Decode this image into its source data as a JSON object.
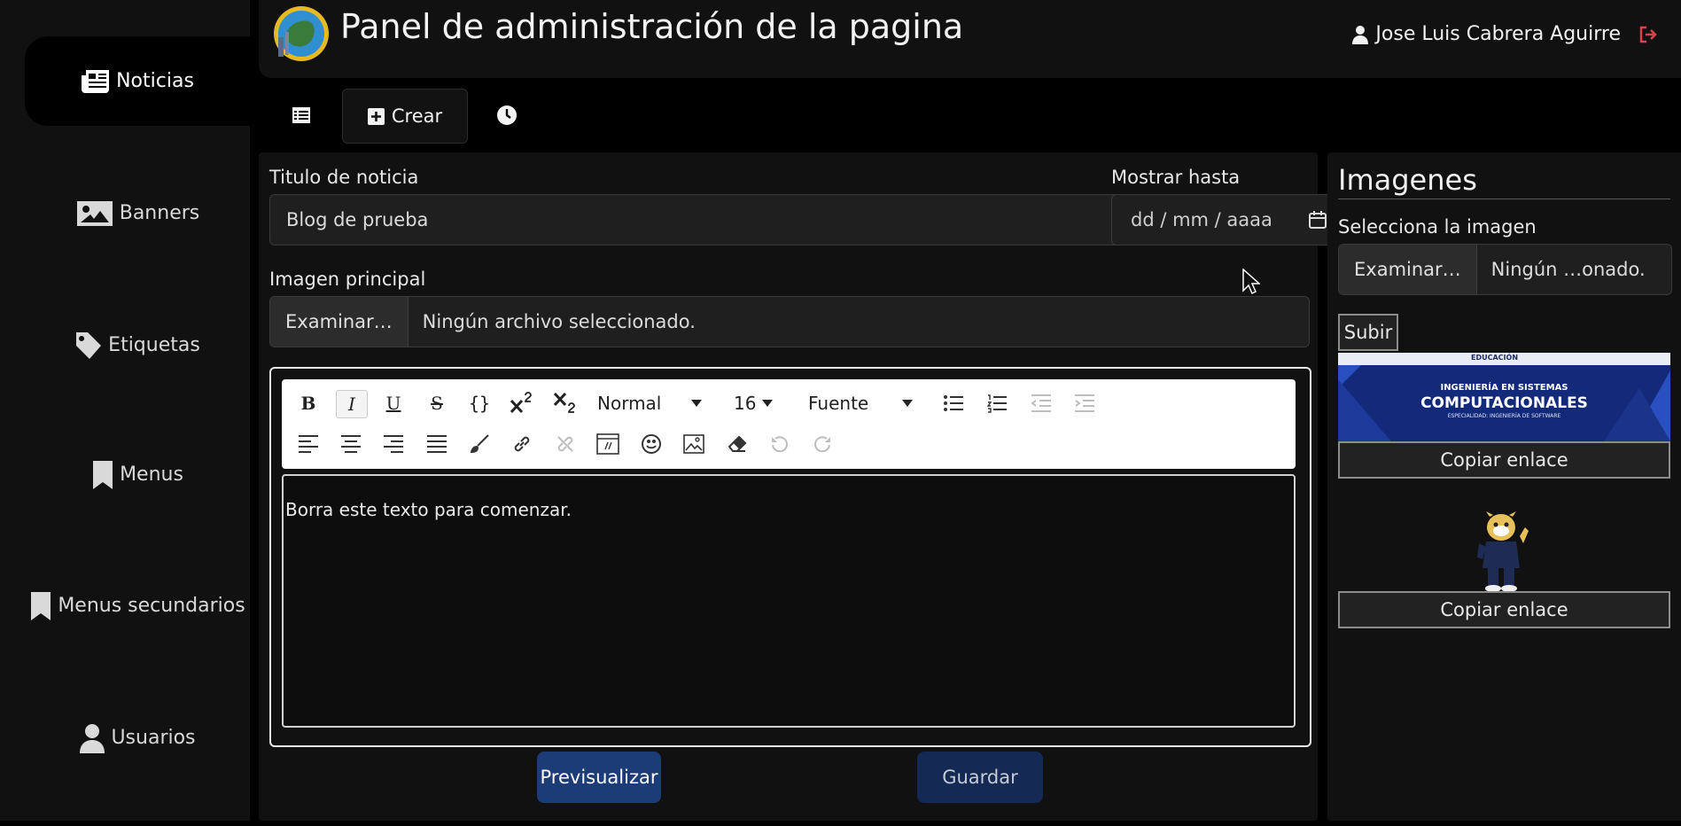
{
  "header": {
    "title": "Panel de administración de la pagina",
    "user_name": "Jose Luis Cabrera Aguirre"
  },
  "sidebar": {
    "items": [
      {
        "label": "Noticias",
        "icon": "newspaper-icon",
        "active": true
      },
      {
        "label": "Banners",
        "icon": "image-icon"
      },
      {
        "label": "Etiquetas",
        "icon": "tag-icon"
      },
      {
        "label": "Menus",
        "icon": "bookmark-icon"
      },
      {
        "label": "Menus secundarios",
        "icon": "bookmark-icon"
      },
      {
        "label": "Usuarios",
        "icon": "user-icon"
      }
    ]
  },
  "tabs": {
    "list_icon": "list-icon",
    "create_label": "Crear",
    "history_icon": "clock-icon"
  },
  "form": {
    "title_label": "Titulo de noticia",
    "title_value": "Blog de prueba",
    "date_label": "Mostrar hasta",
    "date_placeholder": "dd / mm / aaaa",
    "image_label": "Imagen principal",
    "browse_label": "Examinar…",
    "no_file_label": "Ningún archivo seleccionado."
  },
  "editor": {
    "format_value": "Normal",
    "size_value": "16",
    "font_value": "Fuente",
    "body_text": "Borra este texto para comenzar."
  },
  "actions": {
    "preview_label": "Previsualizar",
    "save_label": "Guardar"
  },
  "images_panel": {
    "title": "Imagenes",
    "select_label": "Selecciona la imagen",
    "browse_label": "Examinar…",
    "no_file_label": "Ningún …onado.",
    "upload_label": "Subir",
    "banner_image": {
      "heading": "EDUCACIÓN",
      "line1": "INGENIERÍA EN SISTEMAS",
      "line2": "COMPUTACIONALES",
      "line3": "ESPECIALIDAD: INGENIERÍA DE SOFTWARE"
    },
    "copy_link_label": "Copiar enlace"
  },
  "colors": {
    "background": "#000000",
    "panel": "#111111",
    "primary_button": "#1c3c78",
    "secondary_button": "#142a54",
    "logout": "#e0404a"
  }
}
